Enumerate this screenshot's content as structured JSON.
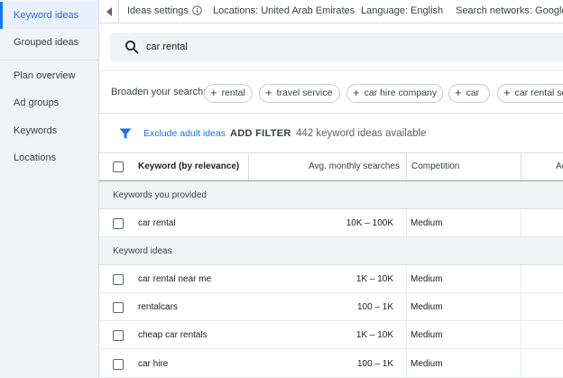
{
  "sidebar": {
    "items": [
      {
        "label": "Keyword ideas"
      },
      {
        "label": "Grouped ideas"
      },
      {
        "label": "Plan overview"
      },
      {
        "label": "Ad groups"
      },
      {
        "label": "Keywords"
      },
      {
        "label": "Locations"
      }
    ]
  },
  "topbar": {
    "ideas_settings": "Ideas settings",
    "locations": "Locations: United Arab Emirates",
    "language": "Language: English",
    "networks": "Search networks: Google"
  },
  "search": {
    "value": "car rental"
  },
  "broaden": {
    "label": "Broaden your search:",
    "chips": [
      "rental",
      "travel service",
      "car hire company",
      "car",
      "car rental se"
    ]
  },
  "filter": {
    "exclude_adult": "Exclude adult ideas",
    "add_filter": "ADD FILTER",
    "available": "442 keyword ideas available"
  },
  "table": {
    "headers": {
      "keyword": "Keyword (by relevance)",
      "volume": "Avg. monthly searches",
      "competition": "Competition",
      "next": "Ac"
    },
    "groups": {
      "provided": "Keywords you provided",
      "ideas": "Keyword ideas"
    },
    "provided_rows": [
      {
        "keyword": "car rental",
        "volume": "10K – 100K",
        "competition": "Medium"
      }
    ],
    "idea_rows": [
      {
        "keyword": "car rental near me",
        "volume": "1K – 10K",
        "competition": "Medium"
      },
      {
        "keyword": "rentalcars",
        "volume": "100 – 1K",
        "competition": "Medium"
      },
      {
        "keyword": "cheap car rentals",
        "volume": "1K – 10K",
        "competition": "Medium"
      },
      {
        "keyword": "car hire",
        "volume": "100 – 1K",
        "competition": "Medium"
      }
    ]
  },
  "colors": {
    "accent": "#1a73e8",
    "sidebar_bg": "#f1f3f4",
    "active_bg": "#e8f0fe"
  }
}
